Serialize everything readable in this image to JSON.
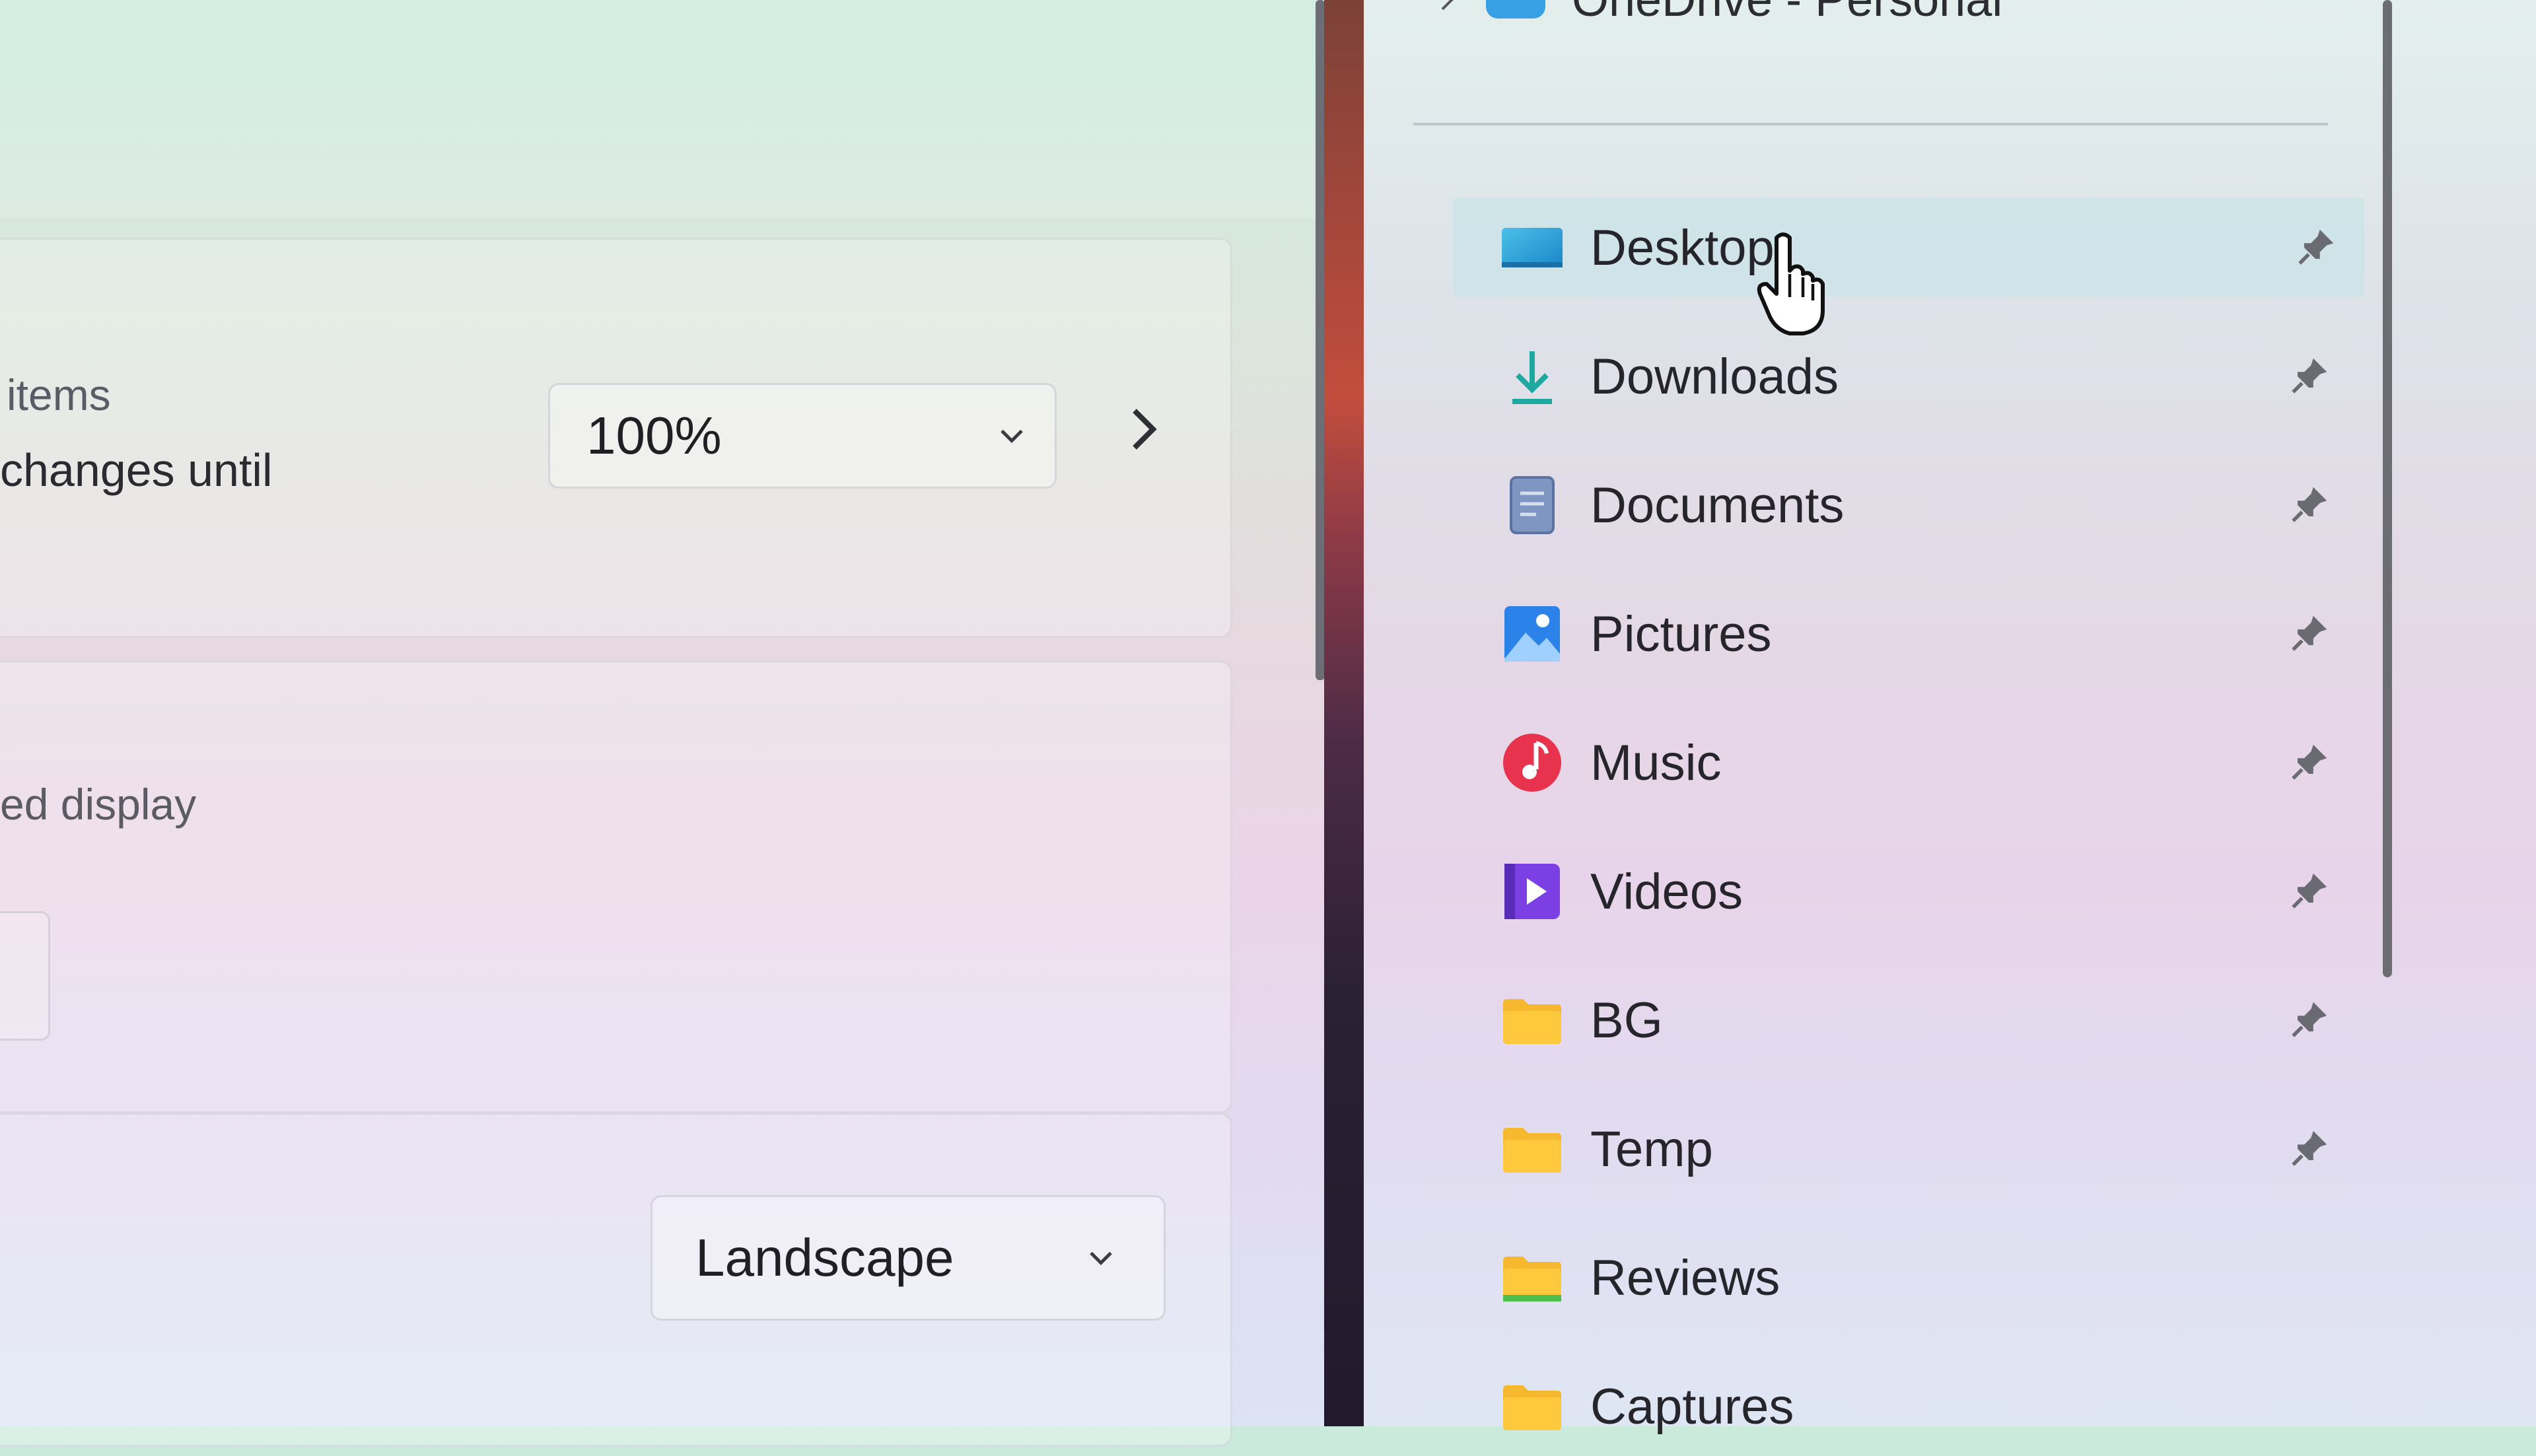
{
  "settings": {
    "row1": {
      "desc_line1": "items",
      "desc_line2": "changes until",
      "scale_value": "100%"
    },
    "row2": {
      "desc": "ed display"
    },
    "orientation": {
      "value": "Landscape"
    }
  },
  "explorer": {
    "onedrive_label": "OneDrive - Personal",
    "quick_access": [
      {
        "label": "Desktop",
        "icon": "desktop-icon",
        "pinned": true
      },
      {
        "label": "Downloads",
        "icon": "downloads-icon",
        "pinned": true
      },
      {
        "label": "Documents",
        "icon": "documents-icon",
        "pinned": true
      },
      {
        "label": "Pictures",
        "icon": "pictures-icon",
        "pinned": true
      },
      {
        "label": "Music",
        "icon": "music-icon",
        "pinned": true
      },
      {
        "label": "Videos",
        "icon": "videos-icon",
        "pinned": true
      },
      {
        "label": "BG",
        "icon": "folder-icon",
        "pinned": true
      },
      {
        "label": "Temp",
        "icon": "folder-icon",
        "pinned": true
      },
      {
        "label": "Reviews",
        "icon": "folder-icon",
        "pinned": false
      },
      {
        "label": "Captures",
        "icon": "folder-icon",
        "pinned": false
      }
    ]
  },
  "colors": {
    "onedrive_blue": "#38a0e4",
    "folder_yellow": "#f5b82e",
    "music_red": "#e8334f",
    "videos_purple": "#7b3fe4",
    "pictures_blue": "#2b82e8"
  }
}
